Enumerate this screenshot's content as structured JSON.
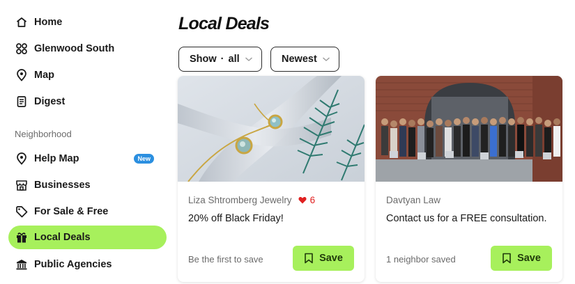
{
  "sidebar": {
    "items": [
      {
        "label": "Home",
        "icon": "home-icon"
      },
      {
        "label": "Glenwood South",
        "icon": "neighborhood-icon"
      },
      {
        "label": "Map",
        "icon": "map-pin-icon"
      },
      {
        "label": "Digest",
        "icon": "digest-icon"
      }
    ],
    "section_title": "Neighborhood",
    "section_items": [
      {
        "label": "Help Map",
        "icon": "map-pin-icon",
        "badge": "New"
      },
      {
        "label": "Businesses",
        "icon": "storefront-icon"
      },
      {
        "label": "For Sale & Free",
        "icon": "tag-icon"
      },
      {
        "label": "Local Deals",
        "icon": "gift-icon",
        "active": true
      },
      {
        "label": "Public Agencies",
        "icon": "government-building-icon"
      }
    ]
  },
  "main": {
    "title": "Local Deals",
    "filters": {
      "show_label": "Show",
      "show_sep": "·",
      "show_value": "all",
      "sort_value": "Newest"
    },
    "cards": [
      {
        "business": "Liza Shtromberg Jewelry",
        "likes": "6",
        "offer": "20% off Black Friday!",
        "saves": "Be the first to save",
        "save_label": "Save"
      },
      {
        "business": "Davtyan Law",
        "offer": "Contact us for a FREE consultation.",
        "saves": "1 neighbor saved",
        "save_label": "Save"
      }
    ]
  },
  "colors": {
    "accent_green": "#a7f05c",
    "badge_blue": "#2b8fe0",
    "heart_red": "#e02020"
  }
}
